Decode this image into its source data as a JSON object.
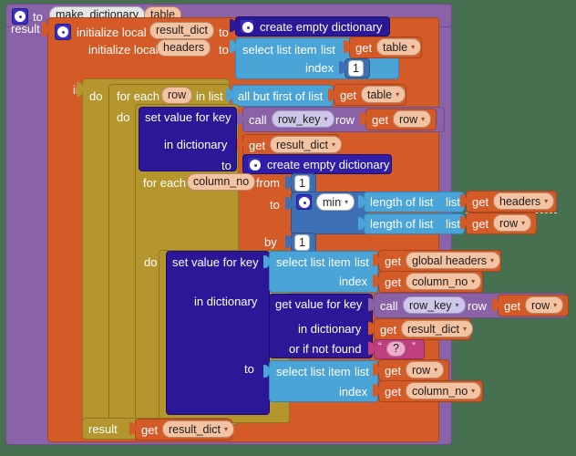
{
  "app": {
    "name": "MIT App Inventor Blocks Editor",
    "canvas_background": "#477050"
  },
  "procedure": {
    "keyword_to": "to",
    "name": "make_dictionary",
    "params": [
      "table"
    ],
    "result_label": "result"
  },
  "blocks": {
    "init_local_1": {
      "label": "initialize local",
      "var": "result_dict",
      "to_label": "to",
      "value": "create empty dictionary"
    },
    "init_local_2": {
      "label": "initialize local",
      "var": "headers",
      "to_label": "to",
      "select_list_item": "select list item",
      "list_label": "list",
      "list_value_get": "get",
      "list_value_var": "table",
      "index_label": "index",
      "index_value": "1"
    },
    "in_label": "in",
    "foreach_row": {
      "do_label": "do",
      "label_pre": "for each",
      "var": "row",
      "label_post": "in list",
      "list_block": "all but first of list",
      "list_get": "get",
      "list_var": "table",
      "inner_do_label": "do"
    },
    "set_value_for_key_1": {
      "label": "set value for key",
      "key_call": "call",
      "key_proc": "row_key",
      "key_arg_label": "row",
      "key_arg_get": "get",
      "key_arg_var": "row",
      "in_dictionary_label": "in dictionary",
      "in_dictionary_get": "get",
      "in_dictionary_var": "result_dict",
      "to_label": "to",
      "to_value": "create empty dictionary"
    },
    "foreach_column": {
      "label_pre": "for each",
      "var": "column_no",
      "from_label": "from",
      "from_value": "1",
      "to_label": "to",
      "min_label": "min",
      "min_arg_1_block": "length of list",
      "min_arg_1_list_label": "list",
      "min_arg_1_get": "get",
      "min_arg_1_var": "headers",
      "min_arg_2_block": "length of list",
      "min_arg_2_list_label": "list",
      "min_arg_2_get": "get",
      "min_arg_2_var": "row",
      "by_label": "by",
      "by_value": "1",
      "do_label": "do"
    },
    "set_value_for_key_2": {
      "label": "set value for key",
      "key_block": "select list item",
      "key_list_label": "list",
      "key_list_get": "get",
      "key_list_var": "global headers",
      "key_index_label": "index",
      "key_index_get": "get",
      "key_index_var": "column_no",
      "in_dictionary_label": "in dictionary",
      "gvfk_label": "get value for key",
      "gvfk_key_call": "call",
      "gvfk_key_proc": "row_key",
      "gvfk_key_arg_label": "row",
      "gvfk_key_arg_get": "get",
      "gvfk_key_arg_var": "row",
      "gvfk_in_dictionary_label": "in dictionary",
      "gvfk_in_dictionary_get": "get",
      "gvfk_in_dictionary_var": "result_dict",
      "gvfk_notfound_label": "or if not found",
      "gvfk_notfound_text": "?",
      "gvfk_quote_open": "“",
      "gvfk_quote_close": "”",
      "to_label": "to",
      "to_block": "select list item",
      "to_list_label": "list",
      "to_list_get": "get",
      "to_list_var": "row",
      "to_index_label": "index",
      "to_index_get": "get",
      "to_index_var": "column_no"
    },
    "result_row": {
      "label": "result",
      "get": "get",
      "var": "result_dict"
    }
  },
  "icons": {
    "mutator_gear": "gear-icon",
    "dropdown_caret": "▾"
  },
  "colors": {
    "procedure_purple": "#8a62a8",
    "local_orange": "#d45b28",
    "dictionary_navy": "#2d1799",
    "list_blue": "#4ba4d8",
    "control_gold": "#b5952e",
    "math_blue": "#3d6fb5",
    "text_magenta": "#bf3f7f",
    "background_green": "#477050"
  }
}
